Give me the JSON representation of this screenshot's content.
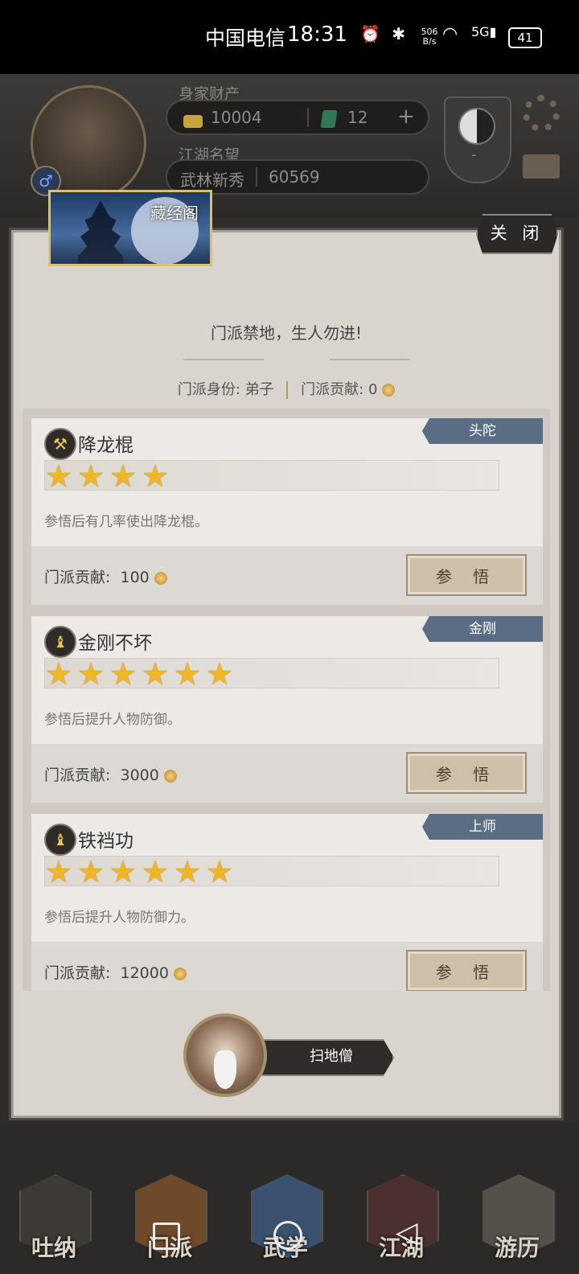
{
  "status_bar": {
    "carrier": "中国电信",
    "time": "18:31",
    "net_speed_value": "506",
    "net_speed_unit": "B/s",
    "signal": "5G",
    "battery": "41"
  },
  "header": {
    "wealth_label": "身家财产",
    "coins": "10004",
    "jade": "12",
    "add": "+",
    "reputation_label": "江湖名望",
    "reputation_title": "武林新秀",
    "reputation_value": "60569",
    "emblem_text": "-"
  },
  "modal": {
    "location": "藏经阁",
    "close_label": "关 闭",
    "motto": "门派禁地，生人勿进!",
    "identity_label": "门派身份:",
    "identity_value": "弟子",
    "contribution_label": "门派贡献:",
    "contribution_value": "0",
    "skills": [
      {
        "name": "降龙棍",
        "tag": "头陀",
        "stars": 4,
        "desc": "参悟后有几率使出降龙棍。",
        "cost_label": "门派贡献:",
        "cost": "100",
        "button": "参 悟",
        "icon": "staff-icon"
      },
      {
        "name": "金刚不坏",
        "tag": "金刚",
        "stars": 6,
        "desc": "参悟后提升人物防御。",
        "cost_label": "门派贡献:",
        "cost": "3000",
        "button": "参 悟",
        "icon": "bell-icon"
      },
      {
        "name": "铁裆功",
        "tag": "上师",
        "stars": 6,
        "desc": "参悟后提升人物防御力。",
        "cost_label": "门派贡献:",
        "cost": "12000",
        "button": "参 悟",
        "icon": "bell-icon"
      }
    ],
    "npc_name": "扫地僧"
  },
  "nav": {
    "items": [
      "吐纳",
      "门派",
      "武学",
      "江湖",
      "游历"
    ]
  },
  "colors": {
    "tag": "#5b6d84",
    "star": "#f0b62a",
    "panel": "#d9d4ce"
  }
}
